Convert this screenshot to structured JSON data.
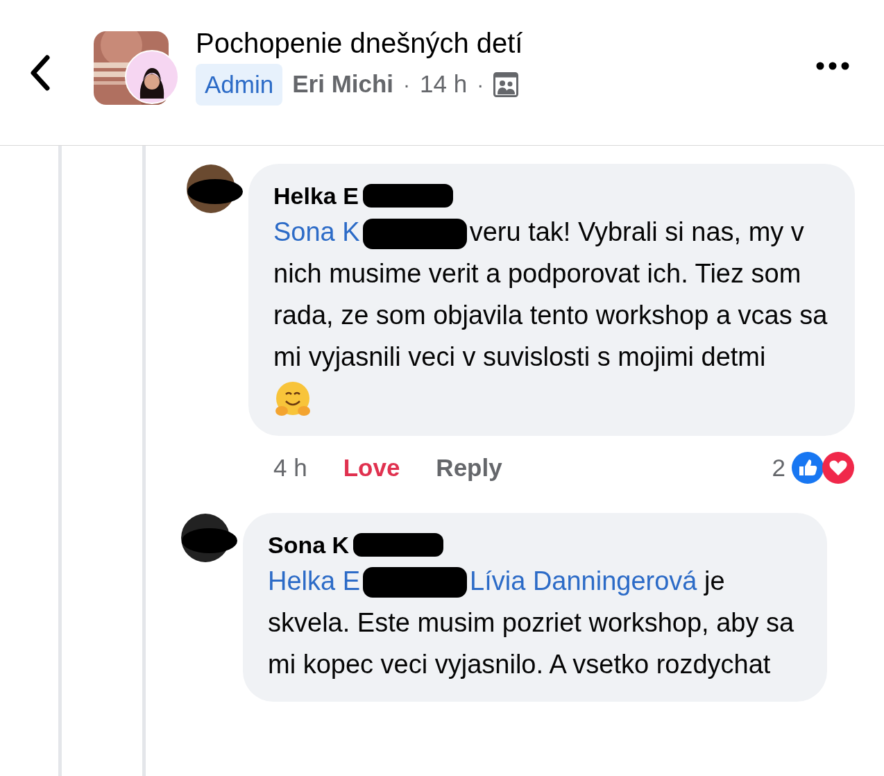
{
  "header": {
    "group_name": "Pochopenie dnešných detí",
    "role_badge": "Admin",
    "author": "Eri Michi",
    "separator_1": "·",
    "time": "14 h",
    "separator_2": "·"
  },
  "comments": [
    {
      "author": "Helka E",
      "author_redacted": true,
      "parts": [
        {
          "kind": "mention",
          "text": "Sona K"
        },
        {
          "kind": "redaction"
        },
        {
          "kind": "text",
          "text": "veru tak! Vybrali si nas, my v nich musime verit a podporovat ich. Tiez som rada, ze som objavila tento workshop a vcas sa mi vyjasnili veci v suvislosti s mojimi detmi"
        }
      ],
      "hug_emoji": true,
      "footer": {
        "time": "4 h",
        "love": "Love",
        "loved": true,
        "reply": "Reply",
        "reaction_count": "2"
      }
    },
    {
      "author": "Sona K",
      "author_redacted": true,
      "parts": [
        {
          "kind": "mention",
          "text": "Helka E"
        },
        {
          "kind": "redaction"
        },
        {
          "kind": "mention",
          "text": "Lívia Danningerová"
        },
        {
          "kind": "text",
          "text": " je skvela. Este musim pozriet workshop, aby sa mi kopec veci vyjasnilo. A vsetko rozdychat"
        }
      ],
      "hug_emoji": false
    }
  ]
}
